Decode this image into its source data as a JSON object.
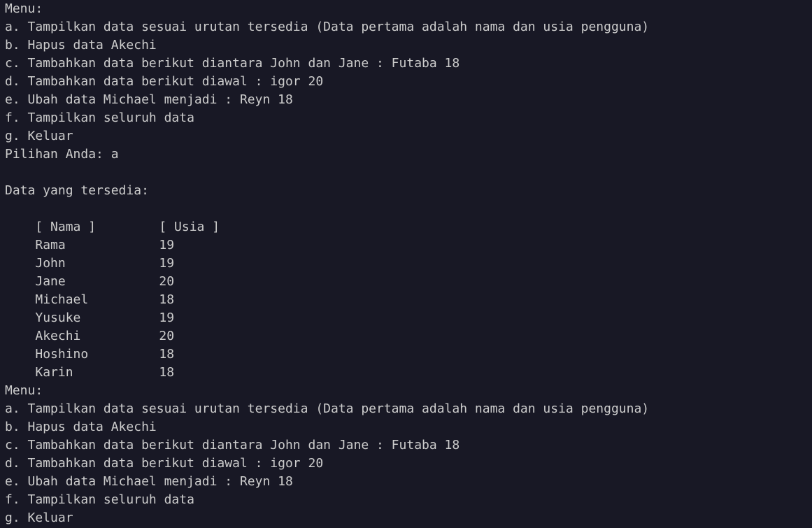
{
  "terminal": {
    "menu1": {
      "title": "Menu:",
      "items": [
        "a. Tampilkan data sesuai urutan tersedia (Data pertama adalah nama dan usia pengguna)",
        "b. Hapus data Akechi",
        "c. Tambahkan data berikut diantara John dan Jane : Futaba 18",
        "d. Tambahkan data berikut diawal : igor 20",
        "e. Ubah data Michael menjadi : Reyn 18",
        "f. Tampilkan seluruh data",
        "g. Keluar"
      ],
      "prompt": "Pilihan Anda: a"
    },
    "data_heading": "Data yang tersedia:",
    "table": {
      "headers": [
        "[ Nama ]",
        "[ Usia ]"
      ],
      "rows": [
        {
          "name": "Rama",
          "age": "19"
        },
        {
          "name": "John",
          "age": "19"
        },
        {
          "name": "Jane",
          "age": "20"
        },
        {
          "name": "Michael",
          "age": "18"
        },
        {
          "name": "Yusuke",
          "age": "19"
        },
        {
          "name": "Akechi",
          "age": "20"
        },
        {
          "name": "Hoshino",
          "age": "18"
        },
        {
          "name": "Karin",
          "age": "18"
        }
      ]
    },
    "menu2": {
      "title": "Menu:",
      "items": [
        "a. Tampilkan data sesuai urutan tersedia (Data pertama adalah nama dan usia pengguna)",
        "b. Hapus data Akechi",
        "c. Tambahkan data berikut diantara John dan Jane : Futaba 18",
        "d. Tambahkan data berikut diawal : igor 20",
        "e. Ubah data Michael menjadi : Reyn 18",
        "f. Tampilkan seluruh data",
        "g. Keluar"
      ]
    }
  },
  "colors": {
    "background": "#181825",
    "text": "#cccccc"
  }
}
